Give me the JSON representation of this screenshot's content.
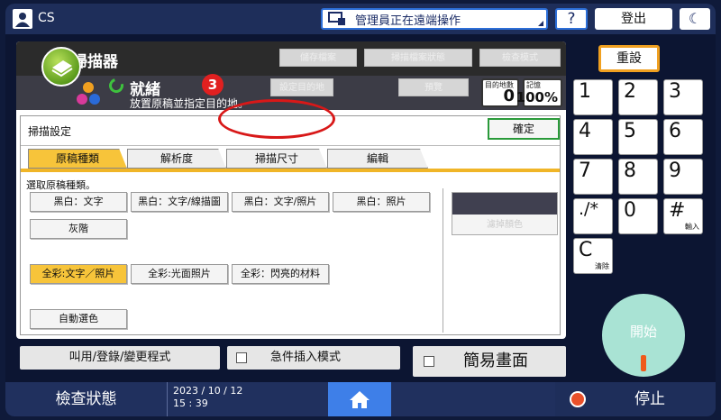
{
  "topbar": {
    "user": "CS",
    "remote_label": "管理員正在遠端操作",
    "help": "?",
    "logout": "登出",
    "moon": "☾"
  },
  "scanner": {
    "title": "掃描器",
    "btn_save": "儲存檔案",
    "btn_file_status": "掃描檔案狀態",
    "btn_check_mode": "檢查模式",
    "btn_dest": "設定目的地",
    "btn_preview": "預覽",
    "ready": "就緒",
    "ready_sub": "放置原稿並指定目的地。",
    "dest_count_label": "目的地數",
    "dest_count": "0",
    "memory_label": "記憶",
    "memory": "100%"
  },
  "settings": {
    "title": "掃描設定",
    "ok": "確定",
    "tabs": [
      "原稿種類",
      "解析度",
      "掃描尺寸",
      "編輯"
    ],
    "prompt": "選取原稿種類。",
    "options": {
      "bw_text": "黑白：文字",
      "bw_text_line": "黑白：文字/線描圖",
      "bw_text_photo": "黑白：文字/照片",
      "bw_photo": "黑白：照片",
      "gray": "灰階",
      "fc_text_photo": "全彩:文字／照片",
      "fc_glossy": "全彩:光面照片",
      "fc_shiny": "全彩：閃亮的材料",
      "auto_color": "自動選色"
    },
    "drop_color": "濾掉顏色",
    "annotation_number": "3"
  },
  "bottom": {
    "program": "叫用/登錄/變更程式",
    "interrupt": "急件插入模式",
    "simple": "簡易畫面"
  },
  "keypad": {
    "reset": "重設",
    "keys": [
      "1",
      "2",
      "3",
      "4",
      "5",
      "6",
      "7",
      "8",
      "9",
      ".∕*",
      "0",
      "#"
    ],
    "key_hash_sub": "輸入",
    "key_c": "C",
    "key_c_sub": "清除",
    "start": "開始"
  },
  "footer": {
    "check_status": "檢查狀態",
    "date": "2023 / 10 / 12",
    "time": "15 : 39",
    "stop": "停止"
  }
}
